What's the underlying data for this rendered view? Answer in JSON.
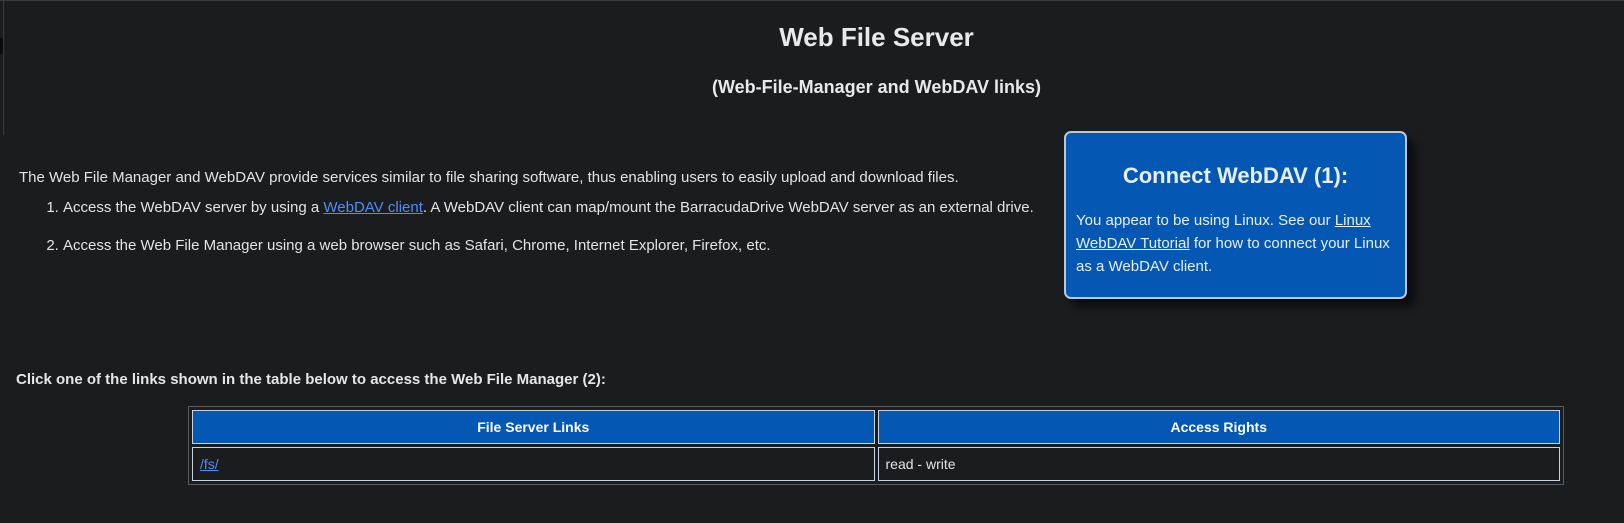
{
  "page": {
    "title": "Web File Server",
    "subtitle": "(Web-File-Manager and WebDAV links)"
  },
  "intro": {
    "text": "The Web File Manager and WebDAV provide services similar to file sharing software, thus enabling users to easily upload and download files.",
    "steps": [
      {
        "prefix": "Access the WebDAV server by using a ",
        "link": "WebDAV client",
        "suffix": ". A WebDAV client can map/mount the BarracudaDrive WebDAV server as an external drive."
      },
      {
        "text": "Access the Web File Manager using a web browser such as Safari, Chrome, Internet Explorer, Firefox, etc."
      }
    ]
  },
  "connect_panel": {
    "heading": "Connect WebDAV (1):",
    "text_prefix": "You appear to be using Linux. See our ",
    "link": "Linux WebDAV Tutorial",
    "text_suffix": " for how to connect your Linux as a WebDAV client."
  },
  "links_section": {
    "note": "Click one of the links shown in the table below to access the Web File Manager (2):",
    "columns": [
      "File Server Links",
      "Access Rights"
    ],
    "rows": [
      {
        "link": "/fs/",
        "rights": "read - write"
      }
    ]
  },
  "colors": {
    "background": "#1b1c1e",
    "accent_blue": "#0457b3",
    "link": "#4f8ef7",
    "text": "#e6e6e6"
  }
}
